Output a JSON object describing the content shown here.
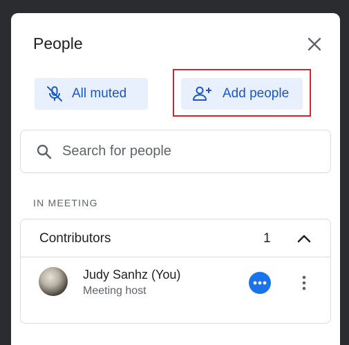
{
  "panel": {
    "title": "People"
  },
  "actions": {
    "mute_label": "All muted",
    "add_label": "Add people"
  },
  "search": {
    "placeholder": "Search for people"
  },
  "section": {
    "label": "IN MEETING"
  },
  "contributors": {
    "title": "Contributors",
    "count": "1",
    "members": [
      {
        "name": "Judy Sanhz (You)",
        "role": "Meeting host"
      }
    ]
  },
  "colors": {
    "accent": "#1a73e8",
    "chip_bg": "#e8f0fe",
    "highlight": "#d3232b"
  }
}
